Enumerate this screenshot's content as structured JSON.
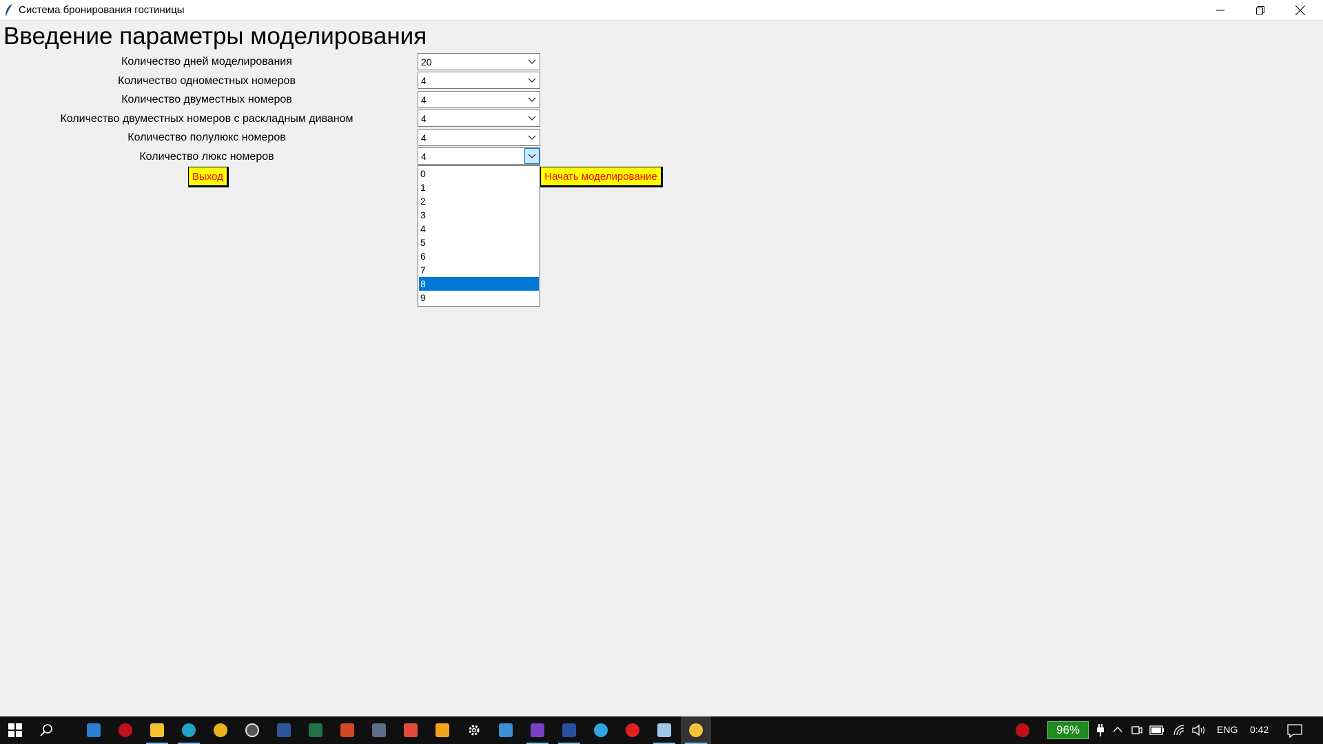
{
  "window": {
    "title": "Система бронирования гостиницы"
  },
  "form": {
    "heading": "Введение параметры моделирования",
    "fields": [
      {
        "label": "Количество дней моделирования",
        "value": "20"
      },
      {
        "label": "Количество одноместных номеров",
        "value": "4"
      },
      {
        "label": "Количество двуместных номеров",
        "value": "4"
      },
      {
        "label": "Количество двуместных номеров с раскладным диваном",
        "value": "4"
      },
      {
        "label": "Количество полулюкс номеров",
        "value": "4"
      },
      {
        "label": "Количество люкс номеров",
        "value": "4"
      }
    ],
    "exit_label": "Выход",
    "start_label": "Начать моделирование"
  },
  "dropdown": {
    "options": [
      "0",
      "1",
      "2",
      "3",
      "4",
      "5",
      "6",
      "7",
      "8",
      "9"
    ],
    "highlighted": "8"
  },
  "colors": {
    "button_bg": "#ffff00",
    "button_text": "#ff0000",
    "selection": "#0078d7"
  },
  "taskbar": {
    "battery_percent": "96%",
    "language": "ENG",
    "time": "0:42",
    "apps": [
      "start-icon",
      "search-icon",
      "store-icon",
      "antivirus-icon",
      "file-explorer-icon",
      "edge-icon",
      "chrome-icon",
      "media-player-icon",
      "word-icon",
      "excel-icon",
      "powerpoint-icon",
      "calculator-icon",
      "snip-icon",
      "outlook-icon",
      "settings-icon",
      "remote-desktop-icon",
      "visual-studio-icon",
      "powershell-icon",
      "telegram-icon",
      "yandex-icon",
      "notepad-icon",
      "python-icon"
    ]
  }
}
